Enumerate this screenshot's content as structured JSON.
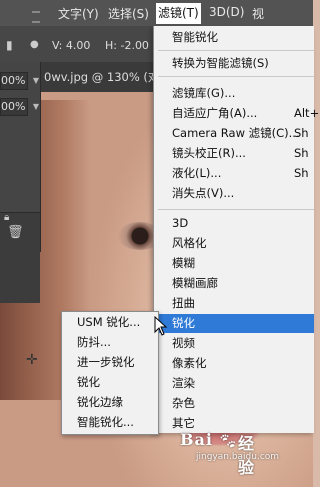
{
  "topbar": {
    "menus": [
      {
        "label": "文字(Y)"
      },
      {
        "label": "选择(S)"
      },
      {
        "label": "滤镜(T)"
      },
      {
        "label": "3D(D)"
      },
      {
        "label": "视"
      }
    ]
  },
  "options": {
    "v_label": "V: 4.00",
    "h_label": "H: -2.00"
  },
  "document": {
    "tab_title": "0wv.jpg @ 130% (对比"
  },
  "left_panel": {
    "opacity_value": "00%",
    "fill_value": "00%"
  },
  "filter_menu": {
    "items": [
      {
        "label": "智能锐化",
        "shortcut": ""
      },
      {
        "label": "转换为智能滤镜(S)",
        "shortcut": ""
      },
      {
        "label": "滤镜库(G)...",
        "shortcut": ""
      },
      {
        "label": "自适应广角(A)...",
        "shortcut": "Alt+Sh"
      },
      {
        "label": "Camera Raw 滤镜(C)...",
        "shortcut": "Sh"
      },
      {
        "label": "镜头校正(R)...",
        "shortcut": "Sh"
      },
      {
        "label": "液化(L)...",
        "shortcut": "Sh"
      },
      {
        "label": "消失点(V)...",
        "shortcut": ""
      },
      {
        "label": "3D",
        "shortcut": ""
      },
      {
        "label": "风格化",
        "shortcut": ""
      },
      {
        "label": "模糊",
        "shortcut": ""
      },
      {
        "label": "模糊画廊",
        "shortcut": ""
      },
      {
        "label": "扭曲",
        "shortcut": ""
      },
      {
        "label": "锐化",
        "shortcut": ""
      },
      {
        "label": "视频",
        "shortcut": ""
      },
      {
        "label": "像素化",
        "shortcut": ""
      },
      {
        "label": "渲染",
        "shortcut": ""
      },
      {
        "label": "杂色",
        "shortcut": ""
      },
      {
        "label": "其它",
        "shortcut": ""
      }
    ]
  },
  "sharpen_submenu": {
    "items": [
      {
        "label": "USM 锐化..."
      },
      {
        "label": "防抖..."
      },
      {
        "label": "进一步锐化"
      },
      {
        "label": "锐化"
      },
      {
        "label": "锐化边缘"
      },
      {
        "label": "智能锐化..."
      }
    ]
  },
  "watermark": {
    "logo_text": "Bai",
    "logo_suffix": "经验",
    "url": "jingyan.baidu.com"
  },
  "colors": {
    "highlight": "#2f7ad6",
    "menu_bg": "#f1f1f1",
    "topbar": "#535353"
  }
}
